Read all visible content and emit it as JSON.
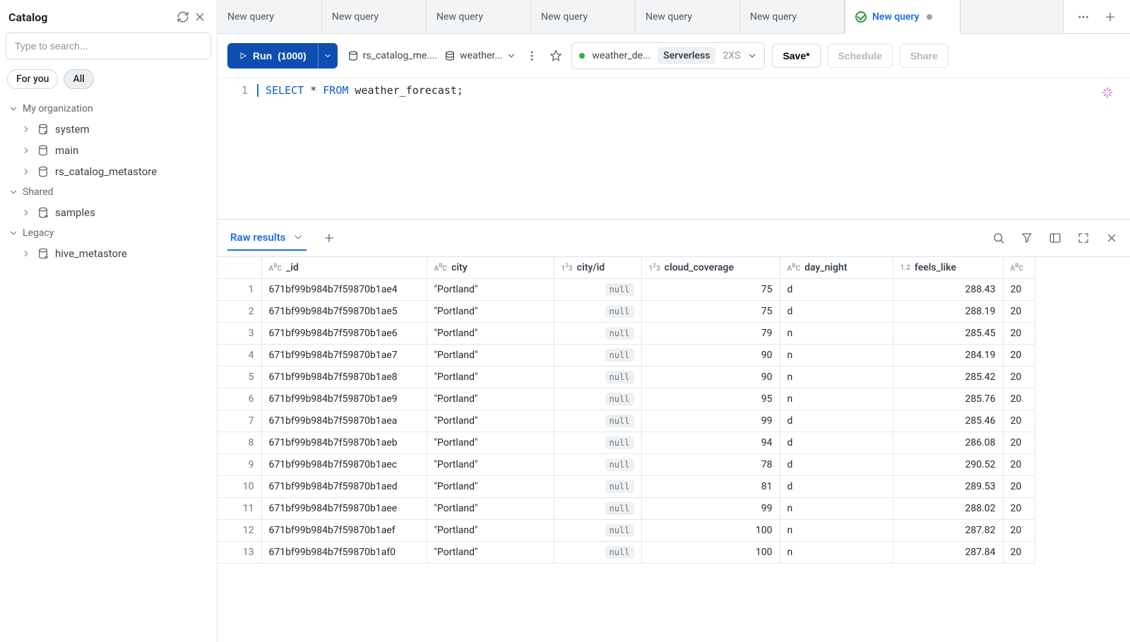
{
  "sidebar": {
    "title": "Catalog",
    "search_placeholder": "Type to search...",
    "pills": {
      "for_you": "For you",
      "all": "All"
    },
    "sections": {
      "org": {
        "label": "My organization",
        "items": [
          "system",
          "main",
          "rs_catalog_metastore"
        ]
      },
      "shared": {
        "label": "Shared",
        "items": [
          "samples"
        ]
      },
      "legacy": {
        "label": "Legacy",
        "items": [
          "hive_metastore"
        ]
      }
    }
  },
  "tabs": {
    "inactive_label": "New query",
    "active_label": "New query"
  },
  "toolbar": {
    "run": "Run",
    "run_count": "(1000)",
    "catalog_sel": "rs_catalog_me....",
    "schema_sel": "weather...",
    "cluster_name": "weather_de...",
    "cluster_mode": "Serverless",
    "cluster_size": "2XS",
    "save": "Save*",
    "schedule": "Schedule",
    "share": "Share"
  },
  "editor": {
    "line_no": "1",
    "sql_kw1": "SELECT",
    "sql_star": " * ",
    "sql_kw2": "FROM",
    "sql_rest": " weather_forecast;"
  },
  "results": {
    "tab": "Raw results",
    "columns": [
      {
        "key": "_id",
        "label": "_id",
        "type": "ABC"
      },
      {
        "key": "city",
        "label": "city",
        "type": "ABC"
      },
      {
        "key": "city_id",
        "label": "city/id",
        "type": "123"
      },
      {
        "key": "cloud_coverage",
        "label": "cloud_coverage",
        "type": "123"
      },
      {
        "key": "day_night",
        "label": "day_night",
        "type": "ABC"
      },
      {
        "key": "feels_like",
        "label": "feels_like",
        "type": "1.2"
      },
      {
        "key": "extra",
        "label": "",
        "type": "ABC"
      }
    ],
    "rows": [
      {
        "_id": "671bf99b984b7f59870b1ae4",
        "city": "\"Portland\"",
        "city_id": null,
        "cloud_coverage": 75,
        "day_night": "d",
        "feels_like": 288.43,
        "extra": "20"
      },
      {
        "_id": "671bf99b984b7f59870b1ae5",
        "city": "\"Portland\"",
        "city_id": null,
        "cloud_coverage": 75,
        "day_night": "d",
        "feels_like": 288.19,
        "extra": "20"
      },
      {
        "_id": "671bf99b984b7f59870b1ae6",
        "city": "\"Portland\"",
        "city_id": null,
        "cloud_coverage": 79,
        "day_night": "n",
        "feels_like": 285.45,
        "extra": "20"
      },
      {
        "_id": "671bf99b984b7f59870b1ae7",
        "city": "\"Portland\"",
        "city_id": null,
        "cloud_coverage": 90,
        "day_night": "n",
        "feels_like": 284.19,
        "extra": "20"
      },
      {
        "_id": "671bf99b984b7f59870b1ae8",
        "city": "\"Portland\"",
        "city_id": null,
        "cloud_coverage": 90,
        "day_night": "n",
        "feels_like": 285.42,
        "extra": "20"
      },
      {
        "_id": "671bf99b984b7f59870b1ae9",
        "city": "\"Portland\"",
        "city_id": null,
        "cloud_coverage": 95,
        "day_night": "n",
        "feels_like": 285.76,
        "extra": "20"
      },
      {
        "_id": "671bf99b984b7f59870b1aea",
        "city": "\"Portland\"",
        "city_id": null,
        "cloud_coverage": 99,
        "day_night": "d",
        "feels_like": 285.46,
        "extra": "20"
      },
      {
        "_id": "671bf99b984b7f59870b1aeb",
        "city": "\"Portland\"",
        "city_id": null,
        "cloud_coverage": 94,
        "day_night": "d",
        "feels_like": 286.08,
        "extra": "20"
      },
      {
        "_id": "671bf99b984b7f59870b1aec",
        "city": "\"Portland\"",
        "city_id": null,
        "cloud_coverage": 78,
        "day_night": "d",
        "feels_like": 290.52,
        "extra": "20"
      },
      {
        "_id": "671bf99b984b7f59870b1aed",
        "city": "\"Portland\"",
        "city_id": null,
        "cloud_coverage": 81,
        "day_night": "d",
        "feels_like": 289.53,
        "extra": "20"
      },
      {
        "_id": "671bf99b984b7f59870b1aee",
        "city": "\"Portland\"",
        "city_id": null,
        "cloud_coverage": 99,
        "day_night": "n",
        "feels_like": 288.02,
        "extra": "20"
      },
      {
        "_id": "671bf99b984b7f59870b1aef",
        "city": "\"Portland\"",
        "city_id": null,
        "cloud_coverage": 100,
        "day_night": "n",
        "feels_like": 287.82,
        "extra": "20"
      },
      {
        "_id": "671bf99b984b7f59870b1af0",
        "city": "\"Portland\"",
        "city_id": null,
        "cloud_coverage": 100,
        "day_night": "n",
        "feels_like": 287.84,
        "extra": "20"
      }
    ]
  }
}
